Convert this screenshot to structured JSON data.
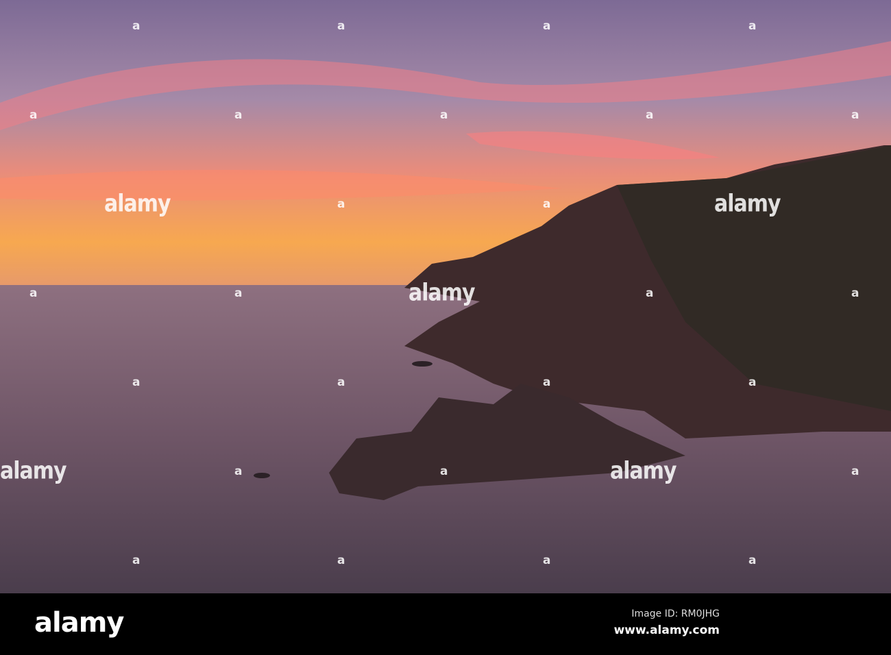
{
  "watermark": {
    "logo": "alamy",
    "marker": "a"
  },
  "footer": {
    "logo": "alamy",
    "image_id": "Image ID: RM0JHG",
    "url": "www.alamy.com"
  }
}
